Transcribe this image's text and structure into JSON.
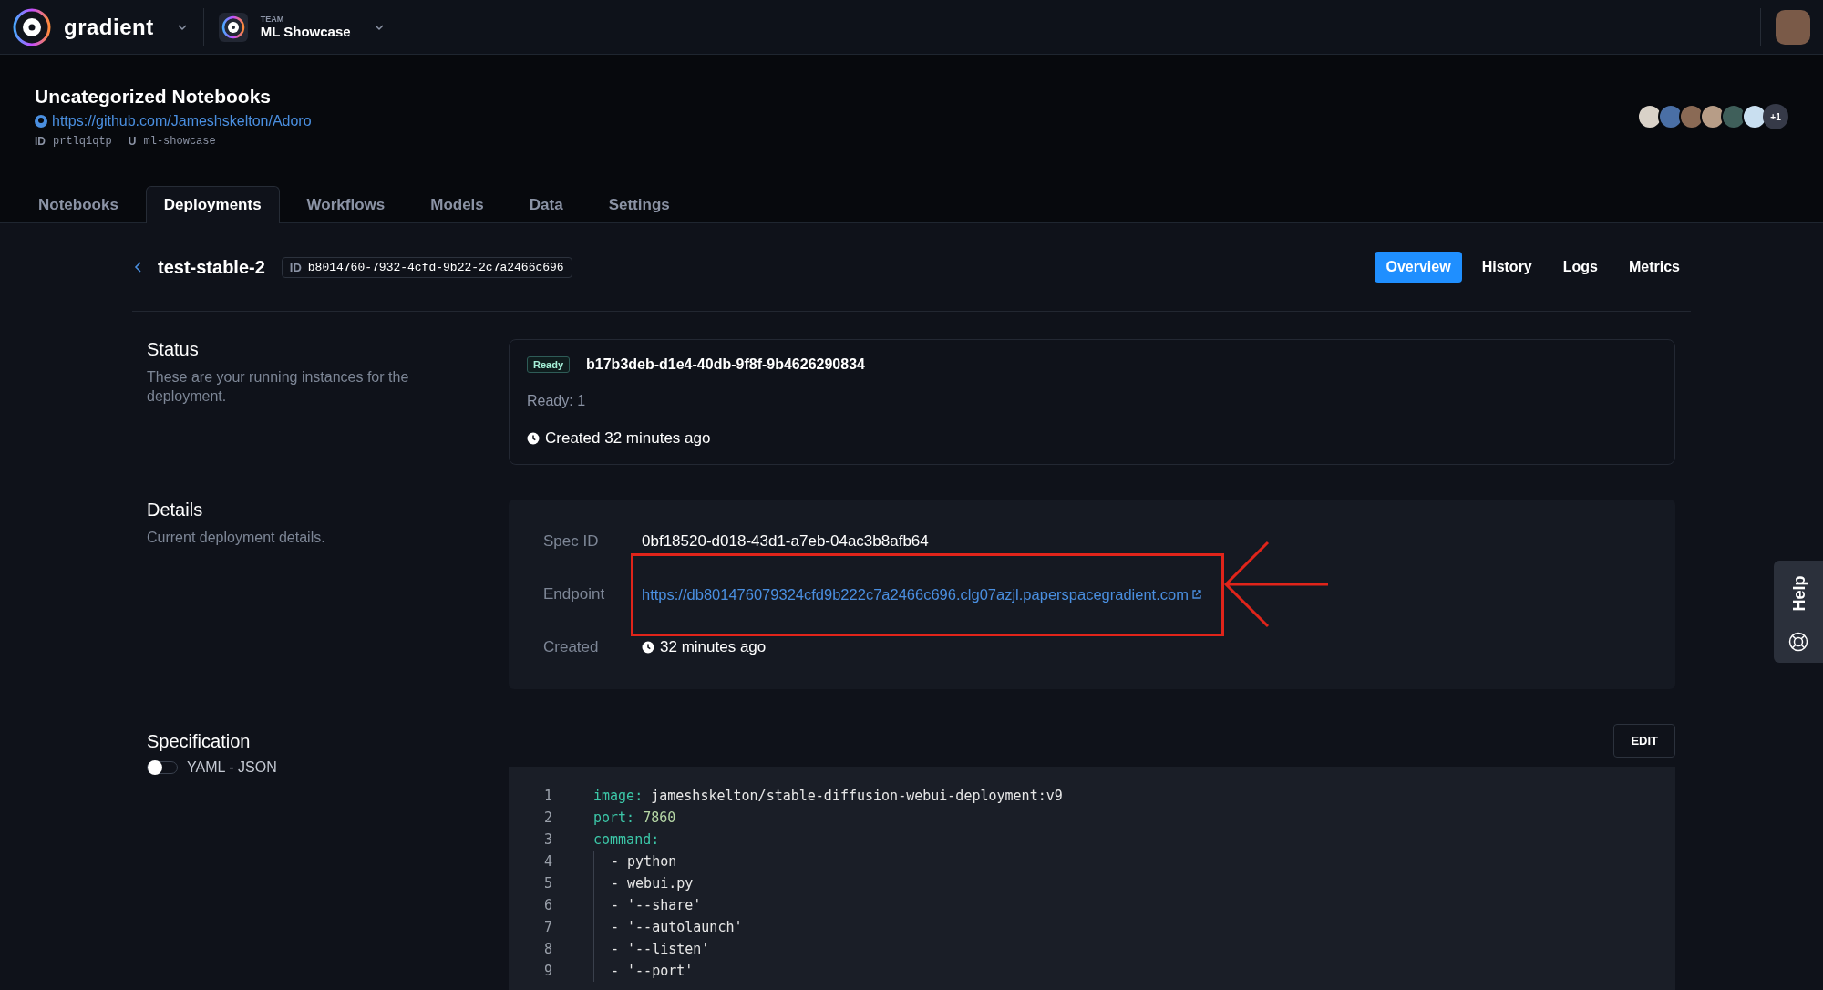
{
  "topbar": {
    "brand": "gradient",
    "team_label": "TEAM",
    "team_name": "ML Showcase"
  },
  "project": {
    "title": "Uncategorized Notebooks",
    "repo_url": "https://github.com/Jameshskelton/Adoro",
    "id_label": "ID",
    "id": "prtlq1qtp",
    "user_label": "U",
    "user": "ml-showcase",
    "member_count_extra": "+1"
  },
  "tabs": [
    {
      "label": "Notebooks",
      "selected": false
    },
    {
      "label": "Deployments",
      "selected": true
    },
    {
      "label": "Workflows",
      "selected": false
    },
    {
      "label": "Models",
      "selected": false
    },
    {
      "label": "Data",
      "selected": false
    },
    {
      "label": "Settings",
      "selected": false
    }
  ],
  "deployment": {
    "name": "test-stable-2",
    "id_label": "ID",
    "id": "b8014760-7932-4cfd-9b22-2c7a2466c696"
  },
  "subtabs": [
    {
      "label": "Overview",
      "selected": true
    },
    {
      "label": "History",
      "selected": false
    },
    {
      "label": "Logs",
      "selected": false
    },
    {
      "label": "Metrics",
      "selected": false
    }
  ],
  "status": {
    "title": "Status",
    "description": "These are your running instances for the deployment.",
    "badge": "Ready",
    "instance_id": "b17b3deb-d1e4-40db-9f8f-9b4626290834",
    "ready_count": "Ready: 1",
    "created": "Created 32 minutes ago"
  },
  "details": {
    "title": "Details",
    "description": "Current deployment details.",
    "rows": [
      {
        "kind": "text",
        "label": "Spec ID",
        "value": "0bf18520-d018-43d1-a7eb-04ac3b8afb64",
        "highlighted": false
      },
      {
        "kind": "link",
        "label": "Endpoint",
        "value": "https://db801476079324cfd9b222c7a2466c696.clg07azjl.paperspacegradient.com",
        "highlighted": true
      },
      {
        "kind": "time",
        "label": "Created",
        "value": "32 minutes ago",
        "highlighted": false
      }
    ]
  },
  "specification": {
    "title": "Specification",
    "toggle_label": "YAML - JSON",
    "toggle_on": false,
    "edit_button": "EDIT",
    "lines": [
      {
        "number": "1",
        "kind": "pair",
        "key": "image:",
        "value": "jameshskelton/stable-diffusion-webui-deployment:v9"
      },
      {
        "number": "2",
        "kind": "number_pair",
        "key": "port:",
        "value": "7860"
      },
      {
        "number": "3",
        "kind": "key",
        "key": "command:"
      },
      {
        "number": "4",
        "kind": "item",
        "value": "- python"
      },
      {
        "number": "5",
        "kind": "item",
        "value": "- webui.py"
      },
      {
        "number": "6",
        "kind": "item",
        "value": "- '--share'"
      },
      {
        "number": "7",
        "kind": "item",
        "value": "- '--autolaunch'"
      },
      {
        "number": "8",
        "kind": "item",
        "value": "- '--listen'"
      },
      {
        "number": "9",
        "kind": "item",
        "value": "- '--port'"
      }
    ]
  },
  "help_tab": {
    "label": "Help"
  }
}
